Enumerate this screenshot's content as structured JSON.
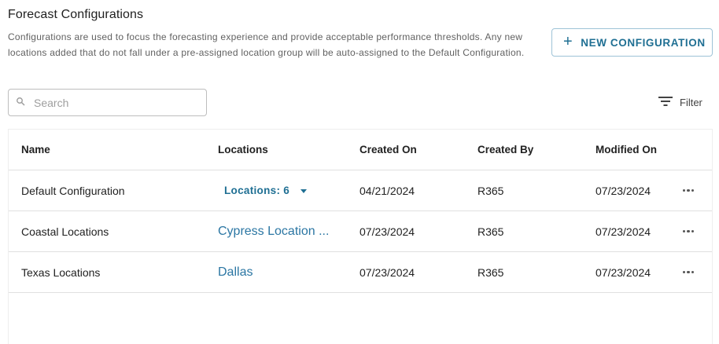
{
  "page": {
    "title": "Forecast Configurations",
    "description": "Configurations are used to focus the forecasting experience and provide acceptable performance thresholds. Any new locations added that do not fall under a pre-assigned location group will be auto-assigned to the Default Configuration."
  },
  "toolbar": {
    "new_button_label": "NEW CONFIGURATION",
    "new_button_icon": "plus-icon",
    "search_placeholder": "Search",
    "filter_label": "Filter"
  },
  "table": {
    "columns": [
      "Name",
      "Locations",
      "Created On",
      "Created By",
      "Modified On"
    ],
    "rows": [
      {
        "name": "Default Configuration",
        "locations": "Locations: 6",
        "created_on": "04/21/2024",
        "created_by": "R365",
        "modified_on": "07/23/2024"
      },
      {
        "name": "Coastal Locations",
        "locations": "Cypress Location ...",
        "created_on": "07/23/2024",
        "created_by": "R365",
        "modified_on": "07/23/2024"
      },
      {
        "name": "Texas Locations",
        "locations": "Dallas",
        "created_on": "07/23/2024",
        "created_by": "R365",
        "modified_on": "07/23/2024"
      }
    ]
  },
  "colors": {
    "accent": "#1f6f93",
    "link": "#2b76a3",
    "border": "#e0e0e0"
  }
}
